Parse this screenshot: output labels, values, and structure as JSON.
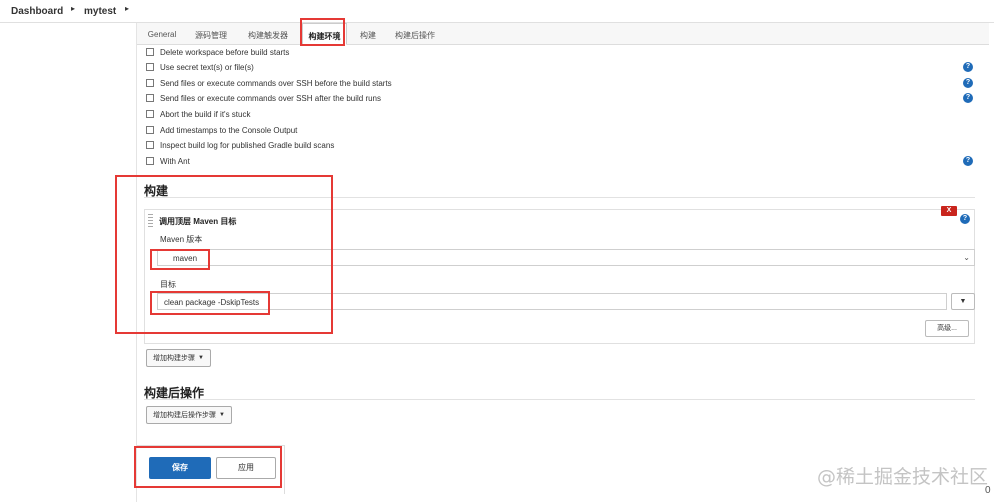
{
  "breadcrumb": {
    "root": "Dashboard",
    "job": "mytest"
  },
  "tabs": [
    "General",
    "源码管理",
    "构建触发器",
    "构建环境",
    "构建",
    "构建后操作"
  ],
  "build_environment": {
    "options": [
      "Delete workspace before build starts",
      "Use secret text(s) or file(s)",
      "Send files or execute commands over SSH before the build starts",
      "Send files or execute commands over SSH after the build runs",
      "Abort the build if it's stuck",
      "Add timestamps to the Console Output",
      "Inspect build log for published Gradle build scans",
      "With Ant"
    ]
  },
  "help_icon": "?",
  "build": {
    "title": "构建",
    "step": {
      "title": "调用顶层 Maven 目标",
      "delete_label": "X",
      "maven_version_label": "Maven 版本",
      "maven_version_value": "maven",
      "goals_label": "目标",
      "goals_value": "clean package -DskipTests",
      "advanced_label": "高级..."
    },
    "add_step_label": "增加构建步骤"
  },
  "post_build": {
    "title": "构建后操作",
    "add_step_label": "增加构建后操作步骤"
  },
  "actions": {
    "save": "保存",
    "apply": "应用"
  },
  "watermark": "@稀土掘金技术社区",
  "edge_glyph": "0",
  "colors": {
    "primary": "#1f6bb8",
    "danger": "#c9251d",
    "highlight": "#e53935"
  }
}
